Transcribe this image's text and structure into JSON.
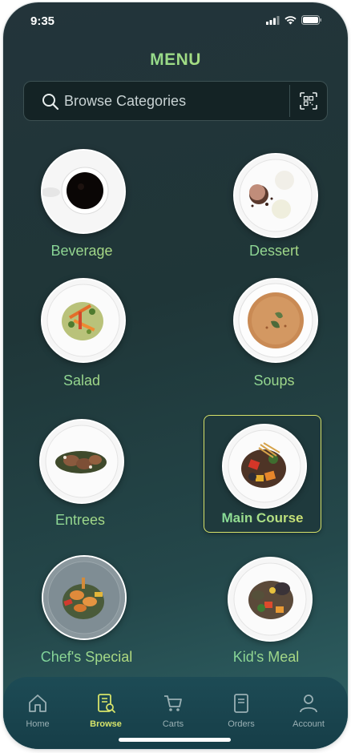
{
  "status_bar": {
    "time": "9:35"
  },
  "header": {
    "title": "MENU"
  },
  "search": {
    "placeholder": "Browse Categories"
  },
  "categories": [
    {
      "label": "Beverage"
    },
    {
      "label": "Dessert"
    },
    {
      "label": "Salad"
    },
    {
      "label": "Soups"
    },
    {
      "label": "Entrees"
    },
    {
      "label": "Main Course",
      "selected": true
    },
    {
      "label": "Chef's Special"
    },
    {
      "label": "Kid's Meal"
    }
  ],
  "nav": {
    "items": [
      {
        "label": "Home",
        "icon": "home-icon"
      },
      {
        "label": "Browse",
        "icon": "browse-icon",
        "active": true
      },
      {
        "label": "Carts",
        "icon": "cart-icon"
      },
      {
        "label": "Orders",
        "icon": "orders-icon"
      },
      {
        "label": "Account",
        "icon": "account-icon"
      }
    ]
  },
  "colors": {
    "accent_green": "#6ed3a6",
    "accent_yellow": "#d7e26a",
    "background": "#1f3638"
  }
}
